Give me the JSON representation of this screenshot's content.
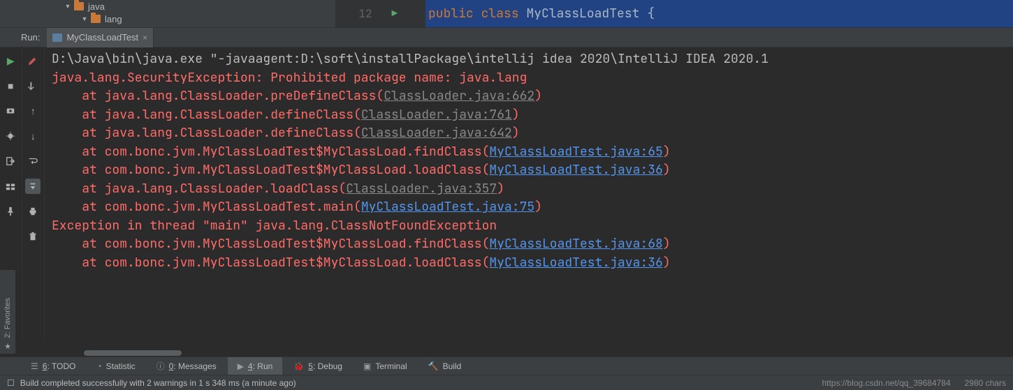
{
  "project_tree": {
    "row1": {
      "indent": 92,
      "name": "java"
    },
    "row2": {
      "indent": 116,
      "name": "lang"
    }
  },
  "editor": {
    "line_no": "12",
    "kw1": "public",
    "kw2": "class",
    "classname": "MyClassLoadTest",
    "brace": "{"
  },
  "run_panel": {
    "label": "Run:",
    "tab_title": "MyClassLoadTest"
  },
  "console": {
    "cmd": "D:\\Java\\bin\\java.exe \"-javaagent:D:\\soft\\installPackage\\intellij idea 2020\\IntelliJ IDEA 2020.1",
    "l1": "java.lang.SecurityException: Prohibited package name: java.lang",
    "at_prefix": "    at ",
    "l2a": "java.lang.ClassLoader.preDefineClass(",
    "l2b": "ClassLoader.java:662",
    "l3a": "java.lang.ClassLoader.defineClass(",
    "l3b": "ClassLoader.java:761",
    "l4a": "java.lang.ClassLoader.defineClass(",
    "l4b": "ClassLoader.java:642",
    "l5a": "com.bonc.jvm.MyClassLoadTest$MyClassLoad.findClass(",
    "l5b": "MyClassLoadTest.java:65",
    "l6a": "com.bonc.jvm.MyClassLoadTest$MyClassLoad.loadClass(",
    "l6b": "MyClassLoadTest.java:36",
    "l7a": "java.lang.ClassLoader.loadClass(",
    "l7b": "ClassLoader.java:357",
    "l8a": "com.bonc.jvm.MyClassLoadTest.main(",
    "l8b": "MyClassLoadTest.java:75",
    "l9": "Exception in thread \"main\" java.lang.ClassNotFoundException",
    "l10a": "com.bonc.jvm.MyClassLoadTest$MyClassLoad.findClass(",
    "l10b": "MyClassLoadTest.java:68",
    "l11a": "com.bonc.jvm.MyClassLoadTest$MyClassLoad.loadClass(",
    "l11b": "MyClassLoadTest.java:36",
    "close_paren": ")"
  },
  "side": {
    "favorites": "2: Favorites"
  },
  "bottom_tabs": {
    "todo": "6: TODO",
    "statistic": "Statistic",
    "messages": "0: Messages",
    "run": "4: Run",
    "debug": "5: Debug",
    "terminal": "Terminal",
    "build": "Build"
  },
  "status": {
    "msg": "Build completed successfully with 2 warnings in 1 s 348 ms (a minute ago)",
    "url": "https://blog.csdn.net/qq_39684784",
    "chars": "2980 chars"
  }
}
